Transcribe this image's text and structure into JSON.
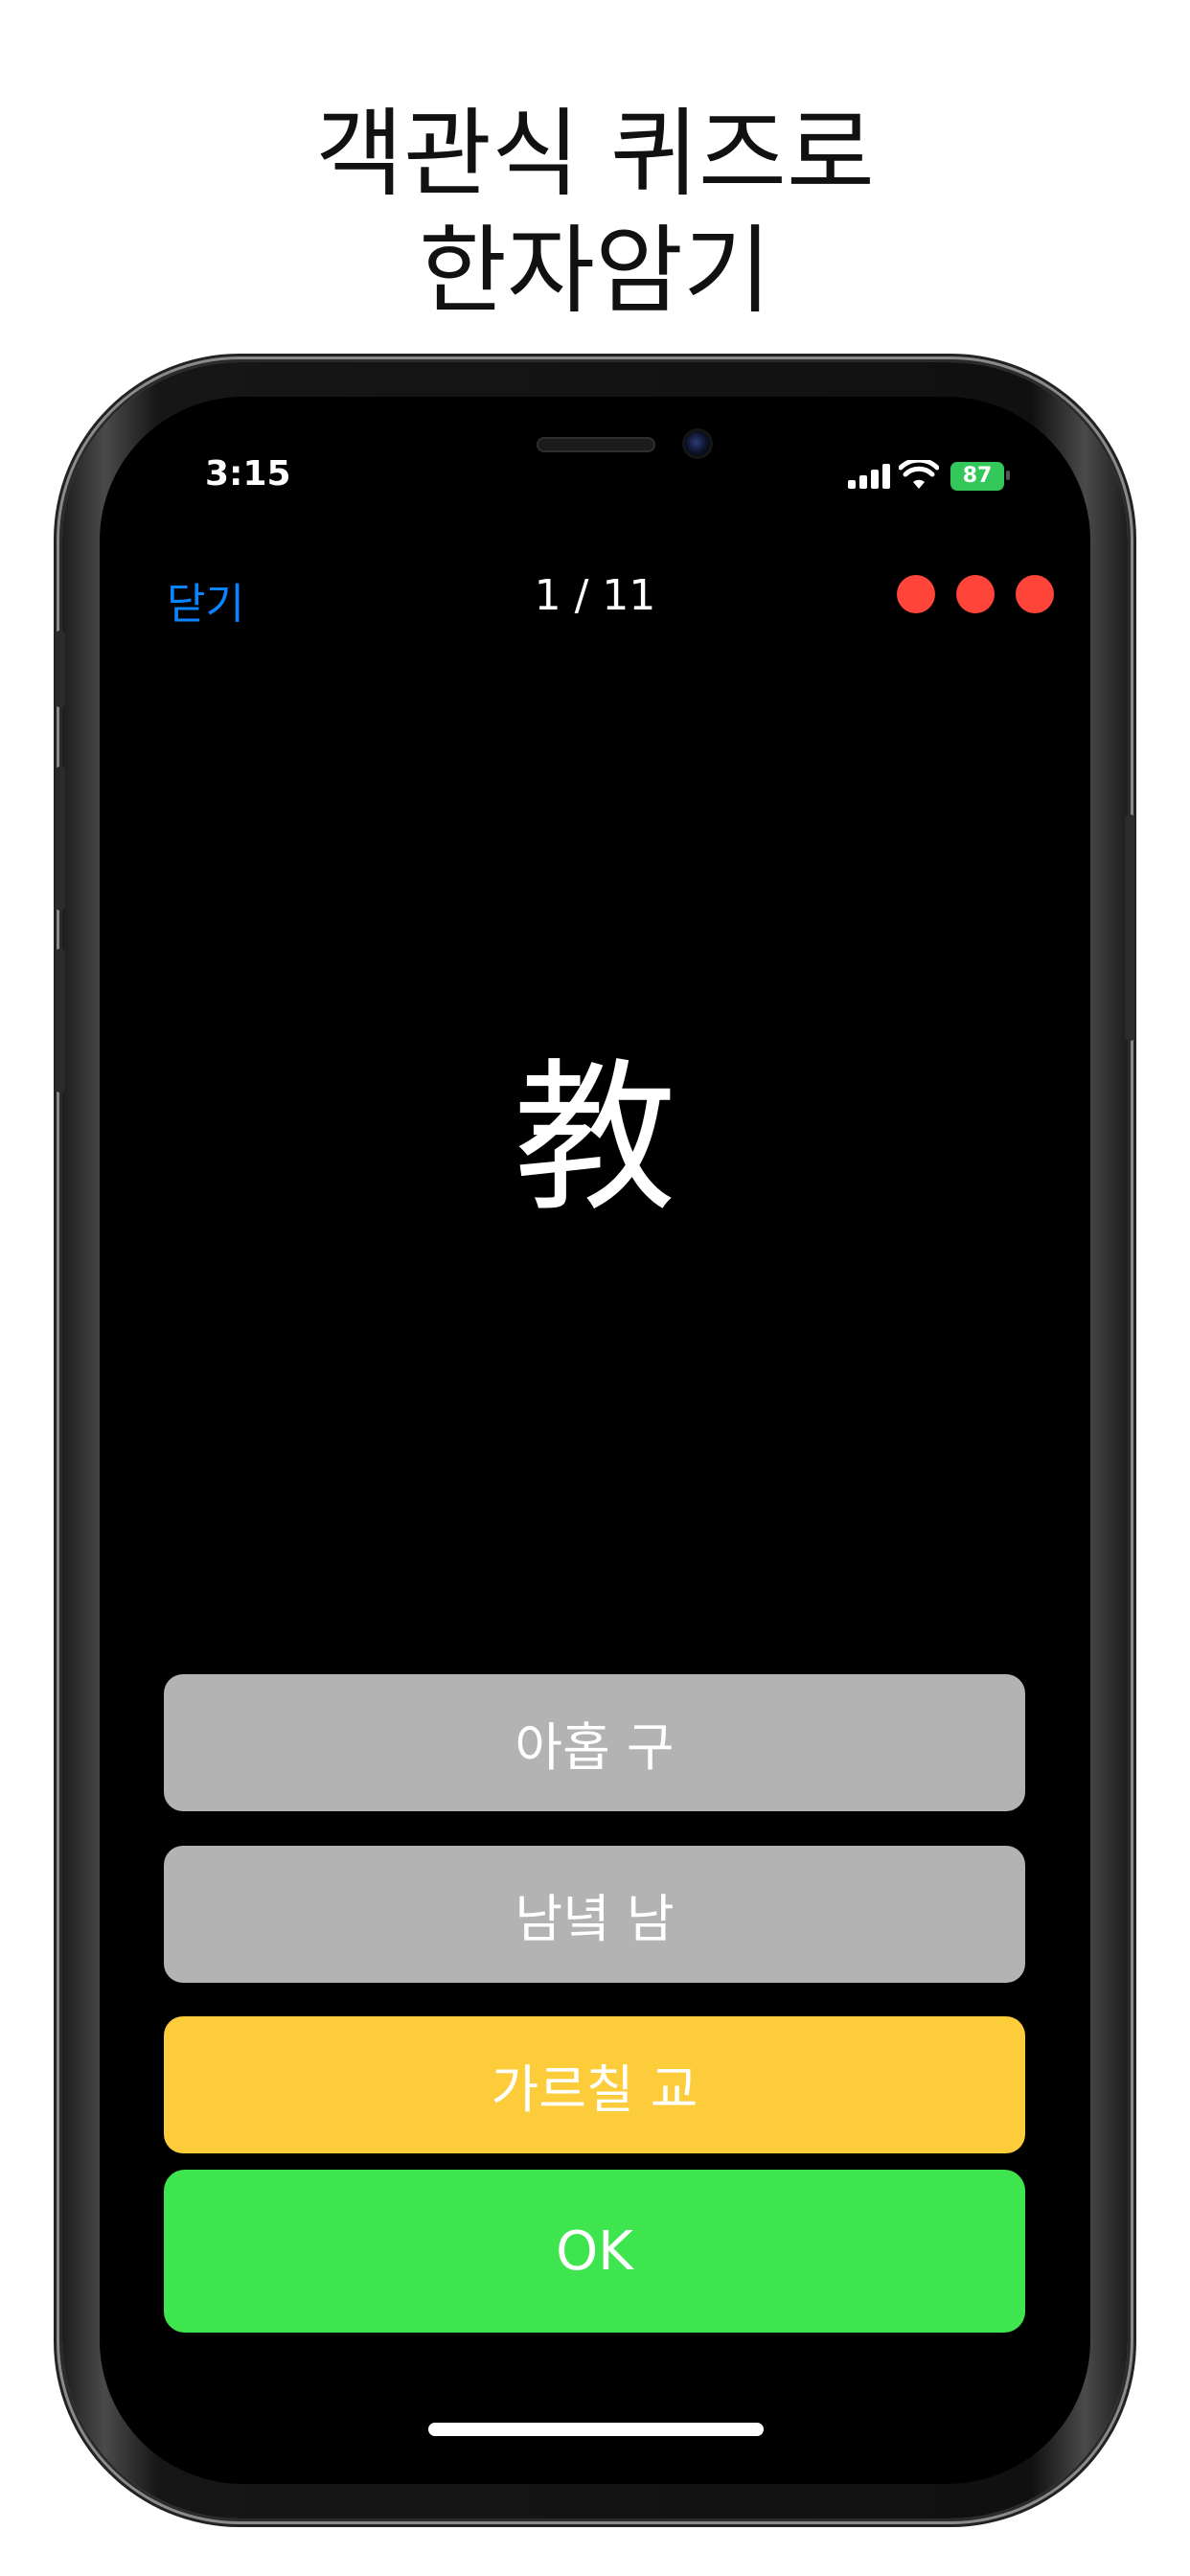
{
  "headline": {
    "line1": "객관식 퀴즈로",
    "line2": "한자암기"
  },
  "status_bar": {
    "time": "3:15",
    "battery": "87",
    "icons": [
      "signal-icon",
      "wifi-icon",
      "battery-icon"
    ]
  },
  "nav": {
    "close_label": "닫기",
    "counter": "1 / 11",
    "lives": 3,
    "life_color": "#ff453a"
  },
  "question": {
    "character": "教"
  },
  "answers": [
    {
      "label": "아홉 구",
      "state": "unselected",
      "color": "#b3b3b3"
    },
    {
      "label": "남녘 남",
      "state": "unselected",
      "color": "#b3b3b3"
    },
    {
      "label": "가르칠 교",
      "state": "selected",
      "color": "#fdcc3a"
    }
  ],
  "ok_button": {
    "label": "OK",
    "color": "#3ee54f"
  },
  "colors": {
    "accent": "#0a84ff",
    "background": "#000000"
  }
}
